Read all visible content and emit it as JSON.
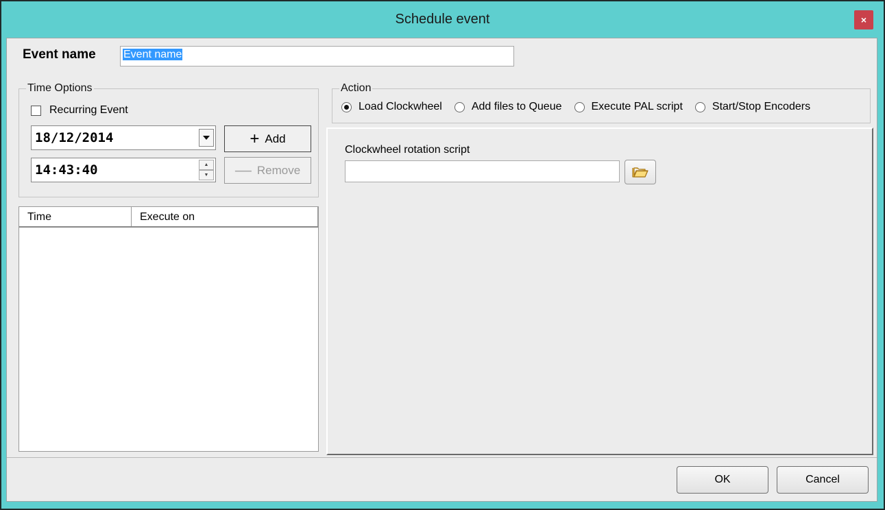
{
  "window": {
    "title": "Schedule event",
    "close_glyph": "×"
  },
  "event": {
    "label": "Event name",
    "value": "Event name"
  },
  "time_options": {
    "legend": "Time Options",
    "recurring_label": "Recurring Event",
    "recurring_checked": false,
    "date_value": "18/12/2014",
    "time_value": "14:43:40",
    "add_label": "Add",
    "remove_label": "Remove"
  },
  "schedule_list": {
    "columns": [
      "Time",
      "Execute on"
    ],
    "rows": []
  },
  "action": {
    "legend": "Action",
    "options": [
      {
        "label": "Load Clockwheel",
        "selected": true
      },
      {
        "label": "Add files to Queue",
        "selected": false
      },
      {
        "label": "Execute PAL script",
        "selected": false
      },
      {
        "label": "Start/Stop Encoders",
        "selected": false
      }
    ],
    "script_label": "Clockwheel rotation script",
    "script_value": ""
  },
  "footer": {
    "ok_label": "OK",
    "cancel_label": "Cancel"
  },
  "icons": {
    "close": "close-icon",
    "dropdown": "chevron-down-icon",
    "add": "plus-icon",
    "remove": "minus-icon",
    "browse": "folder-icon"
  },
  "colors": {
    "titlebar": "#5ecfcf",
    "close_button": "#c9414b",
    "selection": "#3399ff",
    "dialog_bg": "#ececec"
  }
}
